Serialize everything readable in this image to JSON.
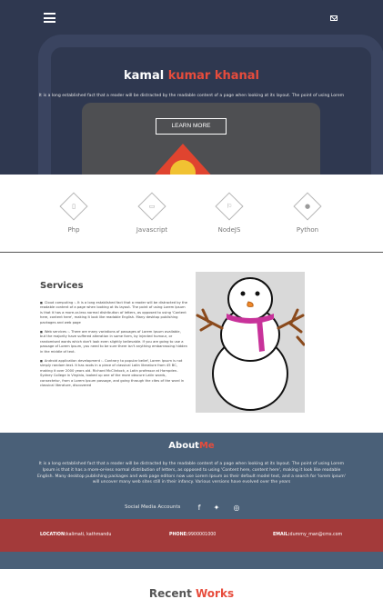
{
  "hero": {
    "name_first": "kamal ",
    "name_accent": "kumar khanal",
    "intro": "It is a long established fact that a reader will be distracted by the readable content of a page when looking at its layout. The point of using Lorem",
    "cta_label": "LEARN MORE",
    "menu_icon": "hamburger-menu-icon",
    "mail_icon": "envelope-icon"
  },
  "skills": [
    {
      "label": "Php",
      "icon": "php-icon",
      "glyph": "▯"
    },
    {
      "label": "Javascript",
      "icon": "javascript-icon",
      "glyph": "▭"
    },
    {
      "label": "NodeJS",
      "icon": "nodejs-icon",
      "glyph": "⚐"
    },
    {
      "label": "Python",
      "icon": "python-icon",
      "glyph": "●"
    }
  ],
  "services": {
    "heading": "Services",
    "items": [
      "Cloud computing :- It is a long established fact that a reader will be distracted by the readable content of a page when looking at its layout. The point of using Lorem Ipsum is that it has a more-or-less normal distribution of letters, as opposed to using 'Content here, content here', making it look like readable English. Many desktop publishing packages and web page",
      "Web services :- There are many variations of passages of Lorem Ipsum available, but the majority have suffered alteration in some form, by injected humour, or randomised words which don't look even slightly believable. If you are going to use a passage of Lorem Ipsum, you need to be sure there isn't anything embarrassing hidden in the middle of text.",
      "Android application development :- Contrary to popular belief, Lorem Ipsum is not simply random text. It has roots in a piece of classical Latin literature from 45 BC, making it over 2000 years old. Richard McClintock, a Latin professor at Hampden-Sydney College in Virginia, looked up one of the more obscure Latin words, consectetur, from a Lorem Ipsum passage, and going through the cites of the word in classical literature, discovered"
    ]
  },
  "about": {
    "heading_first": "About",
    "heading_accent": "Me",
    "text": "It is a long established fact that a reader will be distracted by the readable content of a page when looking at its layout. The point of using Lorem Ipsum is that it has a more-or-less normal distribution of letters, as opposed to using 'Content here, content here', making it look like readable English. Many desktop publishing packages and web page editors now use Lorem Ipsum as their default model text, and a search for 'lorem ipsum' will uncover many web sites still in their infancy. Various versions have evolved over the years",
    "social_label": "Social Media Accounts",
    "social": [
      {
        "icon": "facebook-icon",
        "glyph": "f"
      },
      {
        "icon": "twitter-icon",
        "glyph": "✦"
      },
      {
        "icon": "dribbble-icon",
        "glyph": "◎"
      }
    ]
  },
  "contact": {
    "location_label": "LOCATION:",
    "location_value": "kalimati, kathmandu",
    "phone_label": "PHONE:",
    "phone_value": "9900001000",
    "email_label": "EMAIL:",
    "email_value": "dummy_man@cms.com"
  },
  "recent": {
    "heading_first": "Recent ",
    "heading_accent": "Works"
  },
  "colors": {
    "accent": "#e74c3c",
    "hero_bg": "#2f3850",
    "about_bg": "#4a6078",
    "contact_bg": "#a33a3a"
  }
}
